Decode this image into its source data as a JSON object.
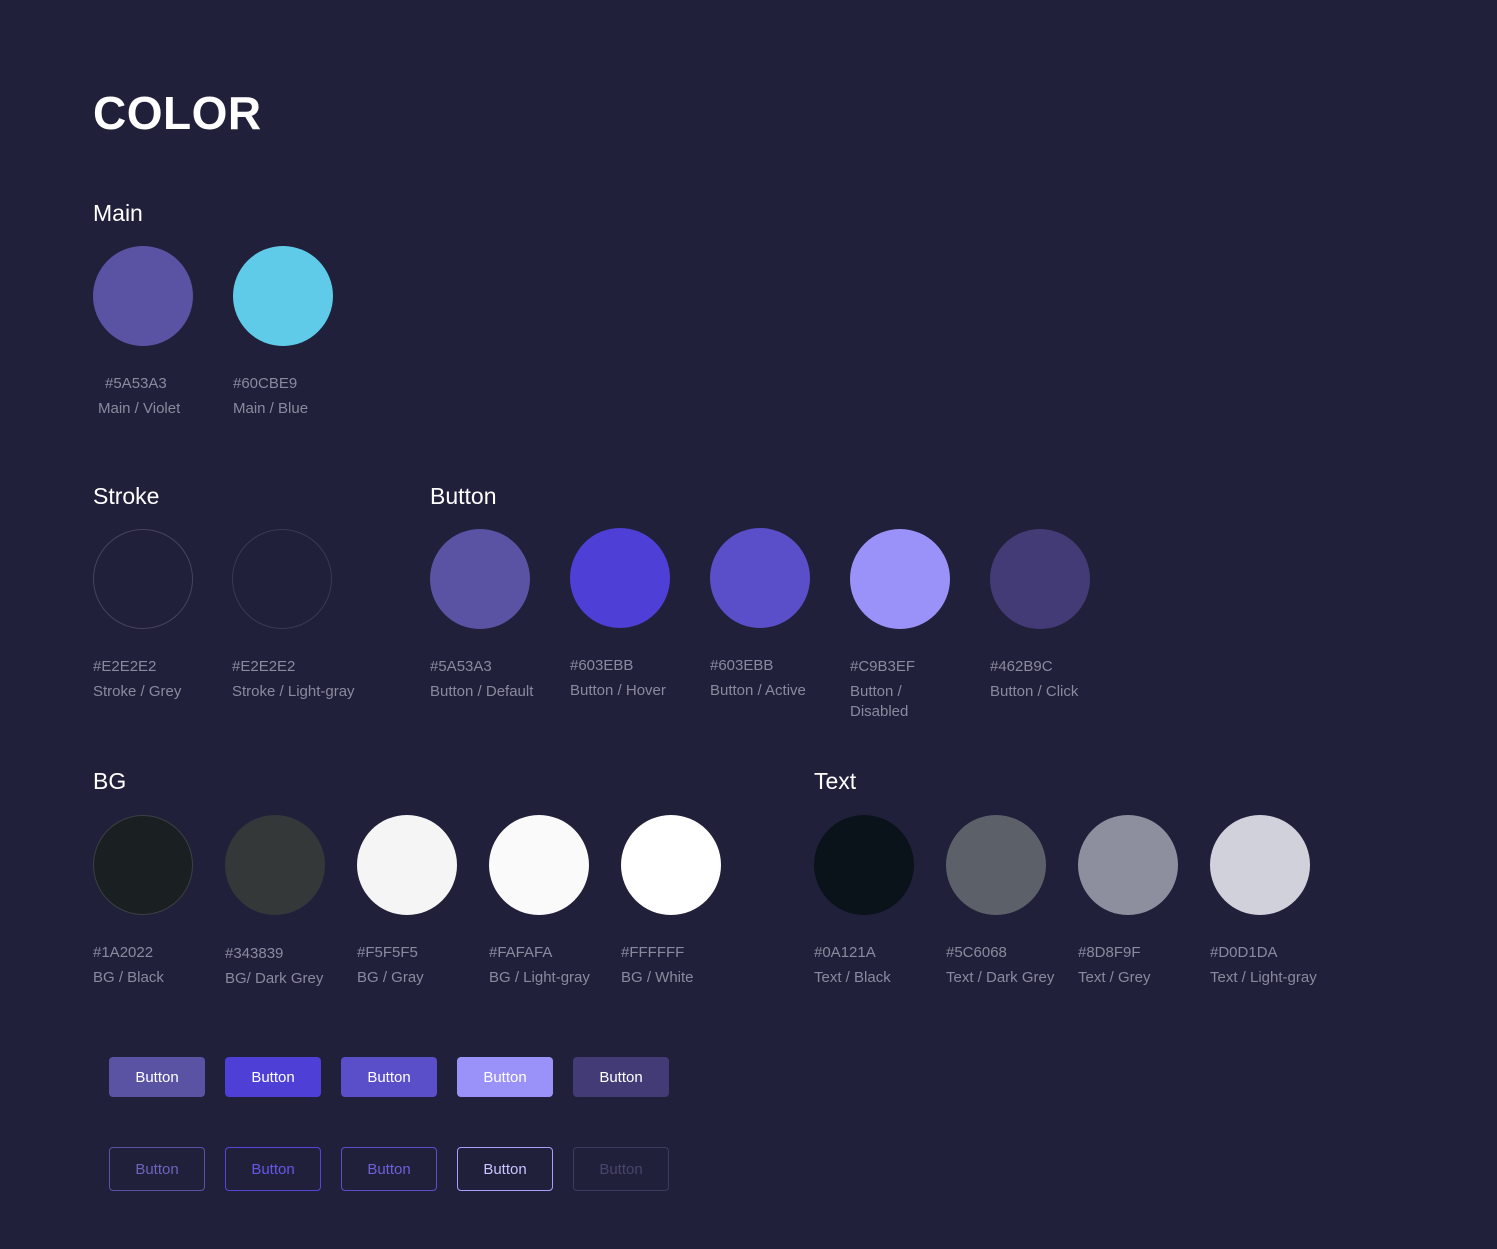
{
  "title": "COLOR",
  "sections": {
    "main": {
      "title": "Main",
      "swatches": [
        {
          "hex": "#5A53A3",
          "label": "Main / Violet",
          "color": "#5a53a3"
        },
        {
          "hex": "#60CBE9",
          "label": "Main / Blue",
          "color": "#60cbe9"
        }
      ]
    },
    "stroke": {
      "title": "Stroke",
      "swatches": [
        {
          "hex": "#E2E2E2",
          "label": "Stroke / Grey",
          "color": "transparent"
        },
        {
          "hex": "#E2E2E2",
          "label": "Stroke / Light-gray",
          "color": "transparent"
        }
      ]
    },
    "button": {
      "title": "Button",
      "swatches": [
        {
          "hex": "#5A53A3",
          "label": "Button / Default",
          "color": "#5a53a3"
        },
        {
          "hex": "#603EBB",
          "label": "Button / Hover",
          "color": "#4e3fd6"
        },
        {
          "hex": "#603EBB",
          "label": "Button / Active",
          "color": "#5a4ec9"
        },
        {
          "hex": "#C9B3EF",
          "label": "Button / Disabled",
          "color": "#9b92f9"
        },
        {
          "hex": "#462B9C",
          "label": "Button / Click",
          "color": "#433b75"
        }
      ]
    },
    "bg": {
      "title": "BG",
      "swatches": [
        {
          "hex": "#1A2022",
          "label": "BG / Black",
          "color": "#1a2022"
        },
        {
          "hex": "#343839",
          "label": "BG/ Dark Grey",
          "color": "#343839"
        },
        {
          "hex": "#F5F5F5",
          "label": "BG / Gray",
          "color": "#f5f5f5"
        },
        {
          "hex": "#FAFAFA",
          "label": "BG / Light-gray",
          "color": "#fafafa"
        },
        {
          "hex": "#FFFFFF",
          "label": "BG / White",
          "color": "#ffffff"
        }
      ]
    },
    "text": {
      "title": "Text",
      "swatches": [
        {
          "hex": "#0A121A",
          "label": "Text / Black",
          "color": "#0a121a"
        },
        {
          "hex": "#5C6068",
          "label": "Text / Dark Grey",
          "color": "#5c6068"
        },
        {
          "hex": "#8D8F9F",
          "label": "Text / Grey",
          "color": "#8d8f9f"
        },
        {
          "hex": "#D0D1DA",
          "label": "Text / Light-gray",
          "color": "#d0d1da"
        }
      ]
    }
  },
  "buttons": {
    "solid": [
      {
        "label": "Button",
        "bg": "#5a53a3",
        "fg": "#ffffff"
      },
      {
        "label": "Button",
        "bg": "#4e3fd6",
        "fg": "#ffffff"
      },
      {
        "label": "Button",
        "bg": "#5a4ec9",
        "fg": "#ffffff"
      },
      {
        "label": "Button",
        "bg": "#9b92f9",
        "fg": "#ffffff"
      },
      {
        "label": "Button",
        "bg": "#433b75",
        "fg": "#ffffff"
      }
    ],
    "outline": [
      {
        "label": "Button",
        "border": "#5a53a3",
        "fg": "#6c64bd"
      },
      {
        "label": "Button",
        "border": "#5446d9",
        "fg": "#6557e6"
      },
      {
        "label": "Button",
        "border": "#5a4ec9",
        "fg": "#6c61d8"
      },
      {
        "label": "Button",
        "border": "#a79ffb",
        "fg": "#c9c3ff"
      },
      {
        "label": "Button",
        "border": "#3d3a5e",
        "fg": "#48456a"
      }
    ]
  }
}
